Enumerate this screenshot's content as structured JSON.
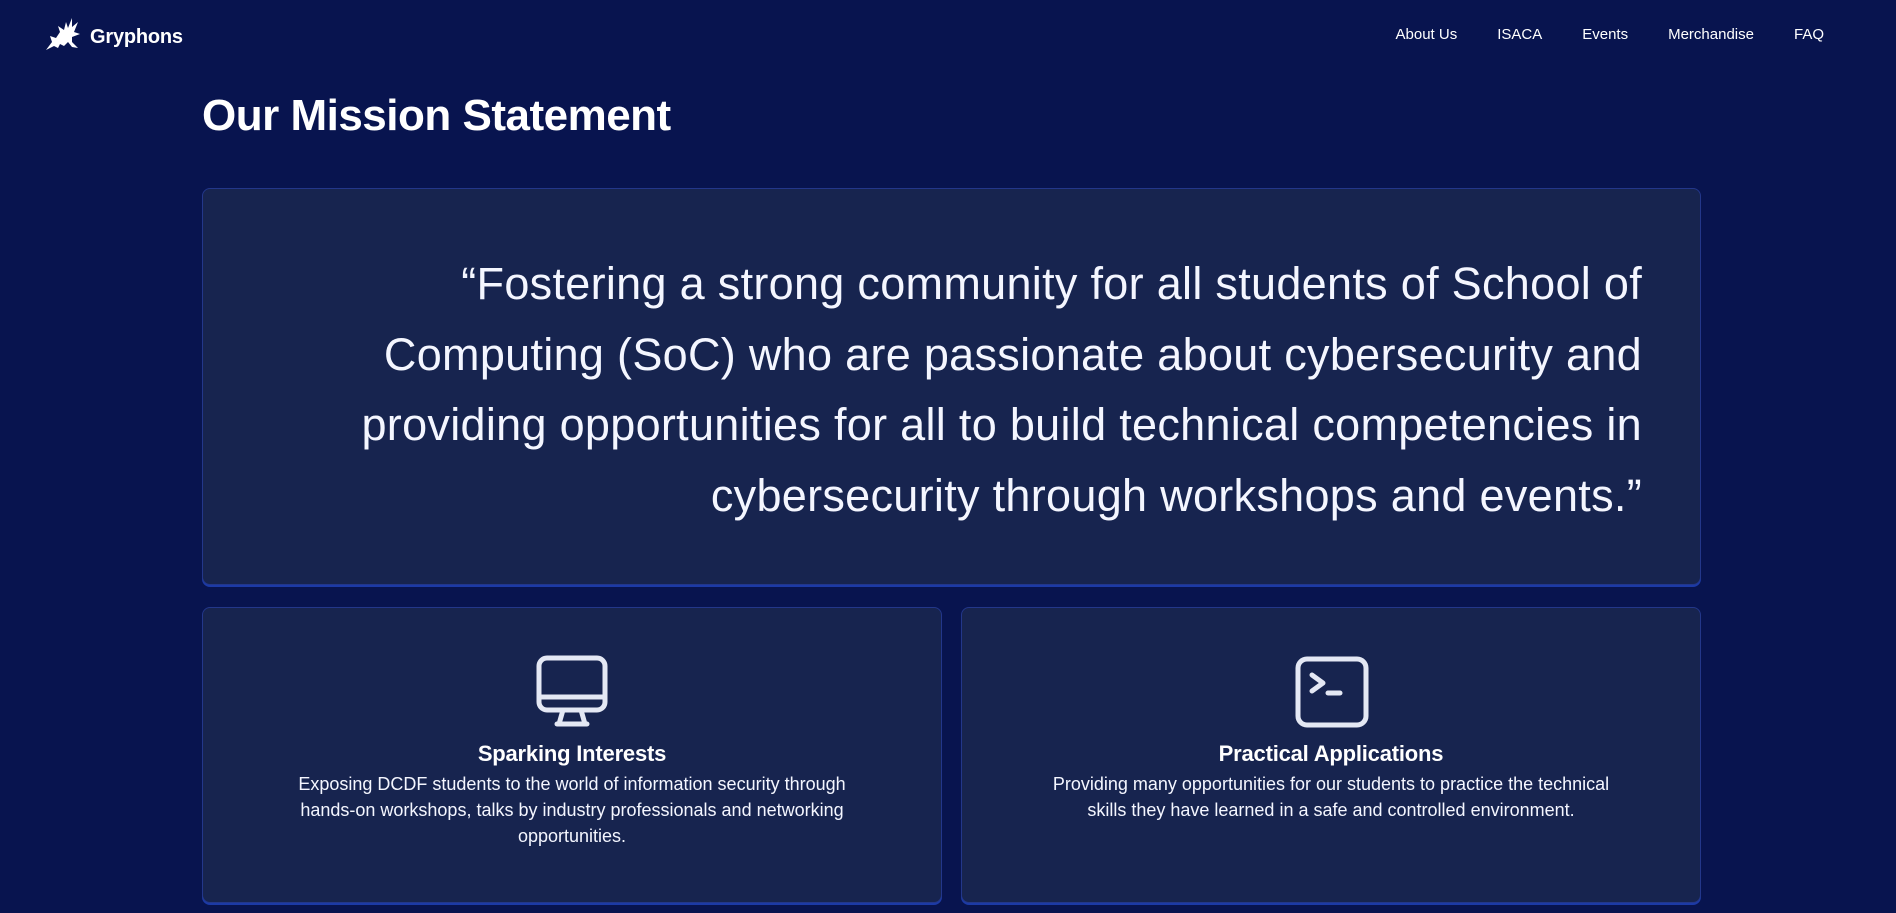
{
  "nav": {
    "brand": "Gryphons",
    "links": [
      {
        "label": "About Us"
      },
      {
        "label": "ISACA"
      },
      {
        "label": "Events"
      },
      {
        "label": "Merchandise"
      },
      {
        "label": "FAQ"
      }
    ]
  },
  "mission": {
    "title": "Our Mission Statement",
    "quote": "“Fostering a strong community for all students of School of Computing (SoC) who are passionate about cybersecurity and providing opportunities for all to build technical competencies in cybersecurity through workshops and events.”"
  },
  "features": [
    {
      "icon": "monitor-icon",
      "title": "Sparking Interests",
      "description": "Exposing DCDF students to the world of information security through hands-on workshops, talks by industry professionals and networking opportunities."
    },
    {
      "icon": "terminal-icon",
      "title": "Practical Applications",
      "description": "Providing many opportunities for our students to practice the technical skills they have learned in a safe and controlled environment."
    }
  ],
  "colors": {
    "background": "#08144f",
    "card": "#17244f",
    "card_border": "#23378a",
    "text": "#ffffff"
  }
}
